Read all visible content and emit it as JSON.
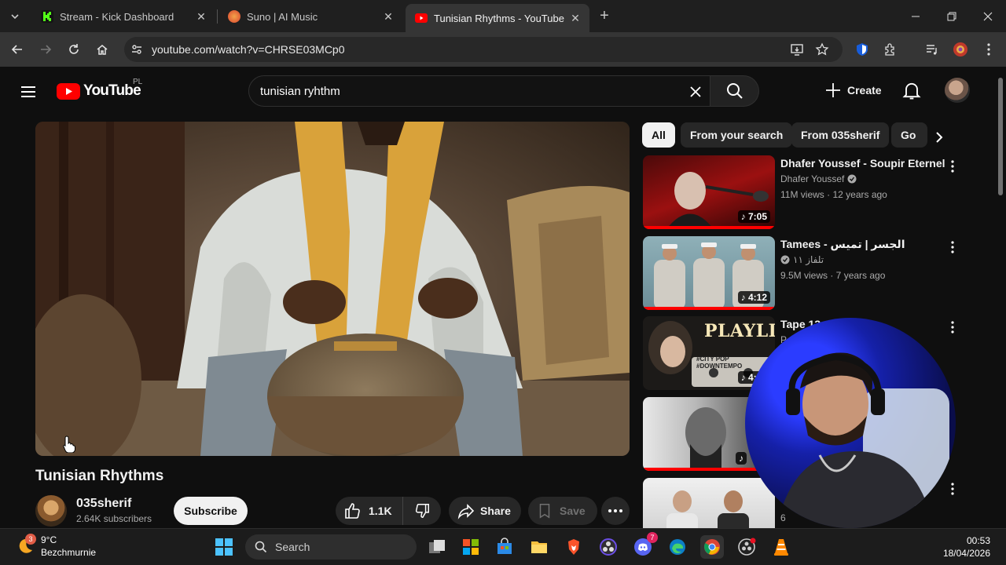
{
  "browser": {
    "tabs": [
      {
        "title": "Stream - Kick Dashboard",
        "favicon_color": "#53fc18"
      },
      {
        "title": "Suno | AI Music",
        "favicon_color": "#e8553a"
      },
      {
        "title": "Tunisian Rhythms - YouTube",
        "favicon_color": "#ff0000"
      }
    ],
    "url": "youtube.com/watch?v=CHRSE03MCp0"
  },
  "youtube": {
    "logo_text": "YouTube",
    "region": "PL",
    "search_query": "tunisian ryhthm",
    "create_label": "Create",
    "video": {
      "title": "Tunisian Rhythms",
      "channel": "035sherif",
      "subscribers": "2.64K subscribers",
      "subscribe_label": "Subscribe",
      "likes": "1.1K",
      "share_label": "Share",
      "save_label": "Save"
    },
    "chips": [
      "All",
      "From your search",
      "From 035sherif",
      "Go"
    ],
    "recommendations": [
      {
        "title": "Dhafer Youssef - Soupir Eternel",
        "channel": "Dhafer Youssef",
        "meta": "11M views · 12 years ago",
        "duration": "7:05"
      },
      {
        "title": "Tamees - الجسر | تميس",
        "channel": "تلفاز ١١",
        "meta": "9.5M views · 7 years ago",
        "duration": "4:12"
      },
      {
        "title": "Tape 13",
        "channel": "P",
        "meta": "",
        "duration": "4:18",
        "thumb_text": "PLAYLIST",
        "thumb_sub": "#CITY POP #DOWNTEMPO"
      },
      {
        "title": "",
        "channel": "",
        "meta": "",
        "duration": ""
      },
      {
        "title": "",
        "channel": "",
        "meta": "6",
        "duration": ""
      }
    ]
  },
  "taskbar": {
    "weather_temp": "9°C",
    "weather_desc": "Bezchmurnie",
    "weather_badge": "3",
    "search_label": "Search",
    "time": "00:53",
    "date": "18/04/2026",
    "discord_badge": "7"
  }
}
